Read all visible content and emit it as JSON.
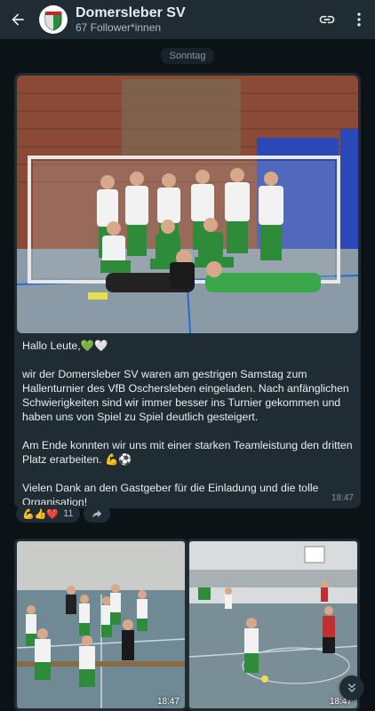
{
  "header": {
    "title": "Domersleber SV",
    "subtitle": "67 Follower*innen",
    "back_icon": "arrow-left-icon",
    "link_icon": "link-icon",
    "menu_icon": "more-vertical-icon"
  },
  "day_label": "Sonntag",
  "post": {
    "paragraphs": [
      "Hallo Leute,💚🤍",
      "wir der Domersleber SV waren am gestrigen Samstag zum Hallenturnier des VfB Oschersleben eingeladen. Nach anfänglichen Schwierigkeiten sind wir immer besser ins Turnier gekommen und haben uns von Spiel zu Spiel deutlich gesteigert.",
      "Am Ende konnten wir uns mit einer starken Teamleistung den dritten Platz erarbeiten. 💪⚽",
      "Vielen Dank an den Gastgeber für die Einladung und die tolle Organisation!"
    ],
    "time": "18:47"
  },
  "reactions": {
    "emojis": "💪👍❤️",
    "count": "11"
  },
  "photos": [
    {
      "time": "18:47"
    },
    {
      "time": "18:47"
    }
  ],
  "colors": {
    "header_bg": "#1f2c33",
    "bubble_bg": "#1f2c33",
    "chat_bg": "#0c1317",
    "text": "#e9edef",
    "secondary_text": "#8696a0"
  }
}
